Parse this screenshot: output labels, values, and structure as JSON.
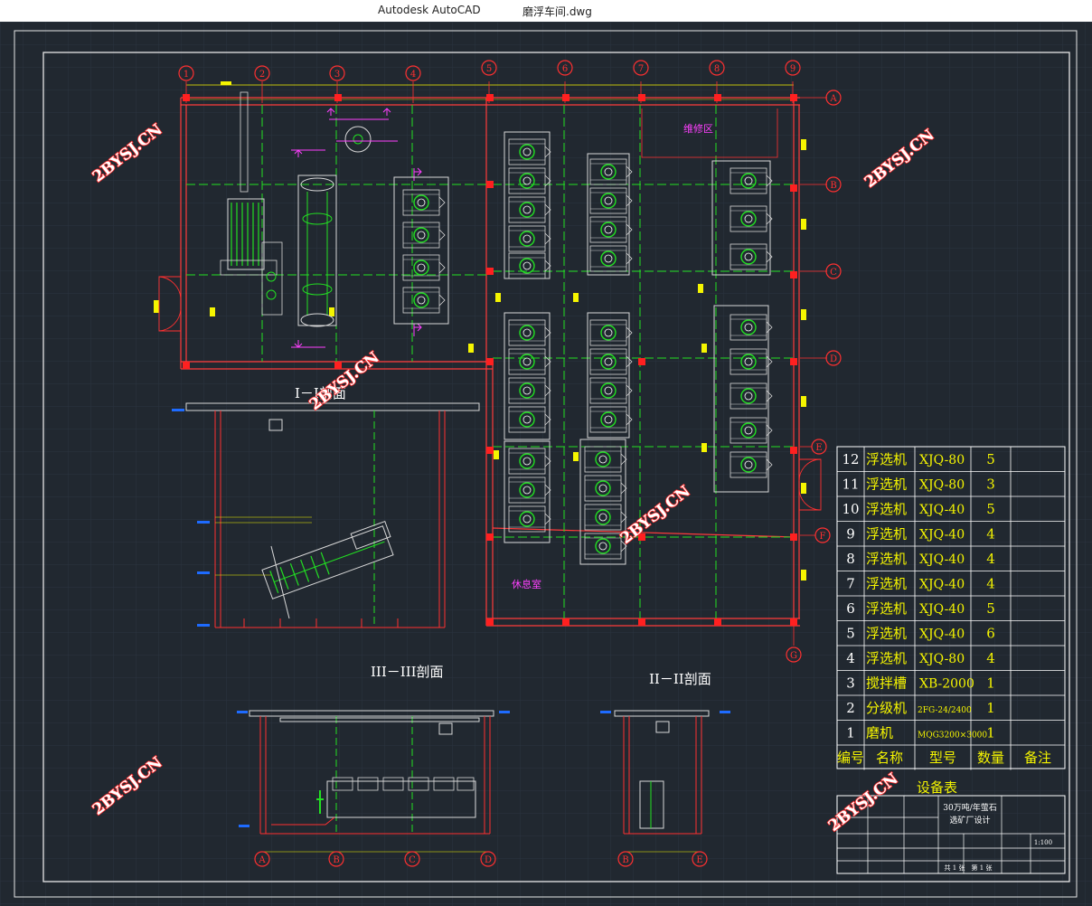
{
  "window": {
    "app_name": "Autodesk AutoCAD",
    "document_name": "磨浮车间.dwg"
  },
  "colors": {
    "background": "#212830",
    "grid": "#2b3440",
    "frame": "#e8e8e8",
    "axis": "#ff3030",
    "axis_line": "#ff3b3b",
    "center_line": "#22e022",
    "equipment": "#d8d8d8",
    "label": "#ffffff",
    "dimension": "#f5f500",
    "watermark": "#ff2a2a",
    "magenta": "#ff40ff"
  },
  "axes": {
    "columns": [
      "1",
      "2",
      "3",
      "4",
      "5",
      "6",
      "7",
      "8",
      "9"
    ],
    "rows": [
      "A",
      "B",
      "C",
      "D",
      "E",
      "F",
      "G"
    ]
  },
  "plan_notes": {
    "maintenance_area": "维修区",
    "rest_room": "休息室"
  },
  "sections": {
    "section_1": "I－I剖面",
    "section_3": "III－III剖面",
    "section_2": "II－II剖面",
    "axis_letters_section3": [
      "A",
      "B",
      "C",
      "D"
    ],
    "axis_letters_section2": [
      "B",
      "E"
    ]
  },
  "watermark": "2BYSJ.CN",
  "equipment_table": {
    "title": "设备表",
    "headers": [
      "编号",
      "名称",
      "型号",
      "数量",
      "备注"
    ],
    "rows": [
      {
        "no": "12",
        "name": "浮选机",
        "model": "XJQ-80",
        "qty": "5",
        "note": ""
      },
      {
        "no": "11",
        "name": "浮选机",
        "model": "XJQ-80",
        "qty": "3",
        "note": ""
      },
      {
        "no": "10",
        "name": "浮选机",
        "model": "XJQ-40",
        "qty": "5",
        "note": ""
      },
      {
        "no": "9",
        "name": "浮选机",
        "model": "XJQ-40",
        "qty": "4",
        "note": ""
      },
      {
        "no": "8",
        "name": "浮选机",
        "model": "XJQ-40",
        "qty": "4",
        "note": ""
      },
      {
        "no": "7",
        "name": "浮选机",
        "model": "XJQ-40",
        "qty": "4",
        "note": ""
      },
      {
        "no": "6",
        "name": "浮选机",
        "model": "XJQ-40",
        "qty": "5",
        "note": ""
      },
      {
        "no": "5",
        "name": "浮选机",
        "model": "XJQ-40",
        "qty": "6",
        "note": ""
      },
      {
        "no": "4",
        "name": "浮选机",
        "model": "XJQ-80",
        "qty": "4",
        "note": ""
      },
      {
        "no": "3",
        "name": "搅拌槽",
        "model": "XB-2000",
        "qty": "1",
        "note": ""
      },
      {
        "no": "2",
        "name": "分级机",
        "model": "2FG-24/2400",
        "qty": "1",
        "note": ""
      },
      {
        "no": "1",
        "name": "磨机",
        "model": "MQG3200×3000",
        "qty": "1",
        "note": ""
      }
    ]
  },
  "title_block": {
    "project_line1": "30万吨/年萤石",
    "project_line2": "选矿厂设计",
    "scale": "1:100",
    "sheet_total": "共 1 张",
    "sheet_no": "第 1 张"
  }
}
